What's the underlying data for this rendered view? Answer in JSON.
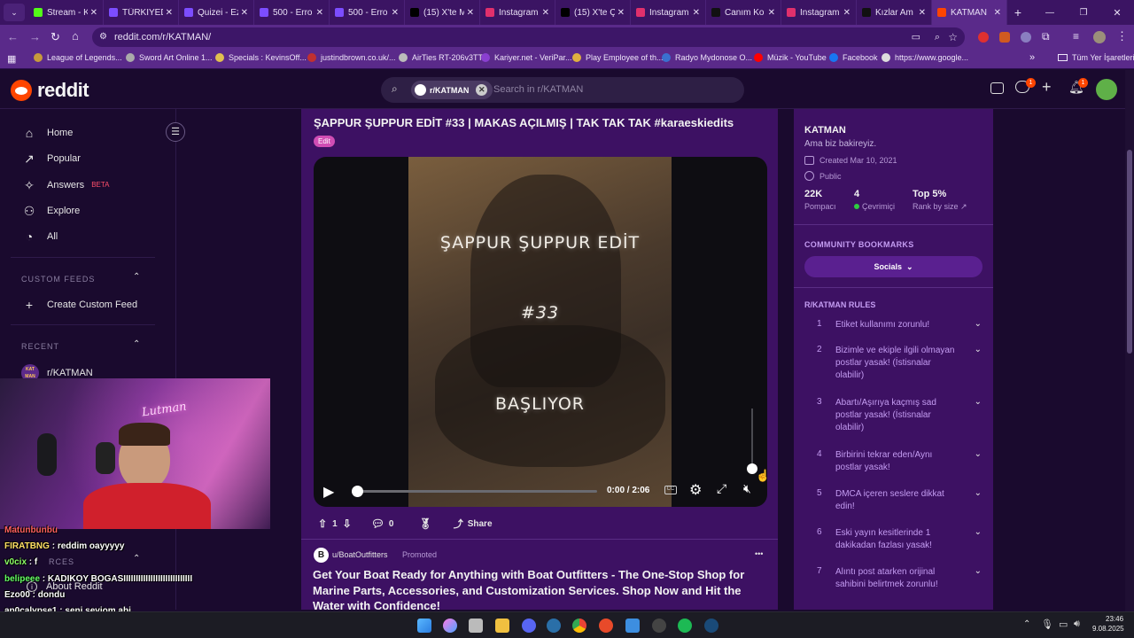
{
  "tabs": [
    {
      "label": "Stream - K",
      "color": "#53fc18"
    },
    {
      "label": "TÜRKİYEDE",
      "color": "#7c4dff"
    },
    {
      "label": "Quizei - Ez",
      "color": "#7c4dff"
    },
    {
      "label": "500 - Erro",
      "color": "#7c4dff"
    },
    {
      "label": "500 - Erro",
      "color": "#7c4dff"
    },
    {
      "label": "(15) X'te M",
      "color": "#000000"
    },
    {
      "label": "Instagram",
      "color": "#e1306c"
    },
    {
      "label": "(15) X'te Ç",
      "color": "#000000"
    },
    {
      "label": "Instagram",
      "color": "#e1306c"
    },
    {
      "label": "Canım Ko",
      "color": "#111111"
    },
    {
      "label": "Instagram",
      "color": "#e1306c"
    },
    {
      "label": "Kızlar Am",
      "color": "#111111"
    },
    {
      "label": "KATMAN",
      "color": "#ff4500"
    }
  ],
  "window_controls": {
    "minimize": "—",
    "restore": "❐",
    "close": "✕"
  },
  "url": "reddit.com/r/KATMAN/",
  "bookmarks": [
    {
      "label": "League of Legends...",
      "color": "#c89b3c"
    },
    {
      "label": "Sword Art Online 1...",
      "color": "#aaaaaa"
    },
    {
      "label": "Specials : KevinsOff...",
      "color": "#e0c050"
    },
    {
      "label": "justindbrown.co.uk/...",
      "color": "#c03030"
    },
    {
      "label": "AirTies RT-206v3TT",
      "color": "#bbbbbb"
    },
    {
      "label": "Kariyer.net - VeriPar...",
      "color": "#8a3fd0"
    },
    {
      "label": "Play Employee of th...",
      "color": "#e0b040"
    },
    {
      "label": "Radyo Mydonose O...",
      "color": "#3a70d0"
    },
    {
      "label": "Müzik - YouTube",
      "color": "#ff0000"
    },
    {
      "label": "Facebook",
      "color": "#1877f2"
    },
    {
      "label": "https://www.google...",
      "color": "#dddddd"
    }
  ],
  "bookmarks_overflow": "»",
  "all_bookmarks": "Tüm Yer İşaretleri",
  "brand": "reddit",
  "search": {
    "chip": "r/KATMAN",
    "placeholder": "Search in r/KATMAN"
  },
  "header_badges": {
    "chat": "1",
    "notifications": "1"
  },
  "left_nav": [
    {
      "label": "Home",
      "icon": "home-icon"
    },
    {
      "label": "Popular",
      "icon": "popular-icon"
    },
    {
      "label": "Answers",
      "badge": "BETA",
      "icon": "answers-icon"
    },
    {
      "label": "Explore",
      "icon": "explore-icon"
    },
    {
      "label": "All",
      "icon": "all-icon"
    }
  ],
  "custom_feeds": {
    "heading": "CUSTOM FEEDS",
    "create": "Create Custom Feed"
  },
  "recent": {
    "heading": "RECENT",
    "item": "r/KATMAN",
    "avatar_text": "KAT MAN"
  },
  "resources_heading": "RCES",
  "about": "About Reddit",
  "post": {
    "title": "ŞAPPUR ŞUPPUR EDİT #33 | MAKAS AÇILMIŞ | TAK TAK TAK #karaeskiedits",
    "flair": "Edit",
    "video_lines": [
      "ŞAPPUR ŞUPPUR EDİT",
      "#33",
      "BAŞLIYOR"
    ],
    "time": "0:00 / 2:06",
    "progress": 0,
    "volume": 0.0,
    "votes": "1",
    "comments": "0",
    "share": "Share"
  },
  "ad": {
    "author": "u/BoatOutfitters",
    "promoted": "Promoted",
    "avatar_letter": "B",
    "title": "Get Your Boat Ready for Anything with Boat Outfitters - The One-Stop Shop for Marine Parts, Accessories, and Customization Services. Shop Now and Hit the Water with Confidence!",
    "more": "•••"
  },
  "community": {
    "name": "KATMAN",
    "description": "Ama biz bakireyiz.",
    "created": "Created Mar 10, 2021",
    "visibility": "Public",
    "members": "22K",
    "members_label": "Pompacı",
    "online": "4",
    "online_label": "Çevrimiçi",
    "rank": "Top 5%",
    "rank_label": "Rank by size"
  },
  "bookmarks_section": {
    "heading": "COMMUNITY BOOKMARKS",
    "button": "Socials"
  },
  "rules_heading": "R/KATMAN RULES",
  "rules": [
    {
      "num": "1",
      "text": "Etiket kullanımı zorunlu!"
    },
    {
      "num": "2",
      "text": "Bizimle ve ekiple ilgili olmayan postlar yasak! (İstisnalar olabilir)"
    },
    {
      "num": "3",
      "text": "Abartı/Aşırıya kaçmış sad postlar yasak! (İstisnalar olabilir)"
    },
    {
      "num": "4",
      "text": "Birbirini tekrar eden/Aynı postlar yasak!"
    },
    {
      "num": "5",
      "text": "DMCA içeren seslere dikkat edin!"
    },
    {
      "num": "6",
      "text": "Eski yayın kesitlerinde 1 dakikadan fazlası yasak!"
    },
    {
      "num": "7",
      "text": "Alıntı post atarken orijinal sahibini belirtmek zorunlu!"
    }
  ],
  "chat": [
    {
      "user": "Matunbunbu",
      "text": "",
      "color": "#ff6060"
    },
    {
      "user": "FIRATBNG",
      "text": "reddim oayyyyy",
      "color": "#ffe066"
    },
    {
      "user": "v0cix",
      "text": "f",
      "color": "#8cff66"
    },
    {
      "user": "belipeee",
      "text": "KADIKOY BOGASIIIIIIIIIIIIIIIIIIIIIIIIIIII",
      "color": "#66ff66"
    },
    {
      "user": "Ezo00",
      "text": "dondu",
      "color": "#ffffff"
    },
    {
      "user": "ap0calypse1",
      "text": "seni seviom abi",
      "color": "#ffffff"
    }
  ],
  "webcam_sign": "Lutman",
  "clock": {
    "time": "23:46",
    "date": "9.08.2025"
  }
}
